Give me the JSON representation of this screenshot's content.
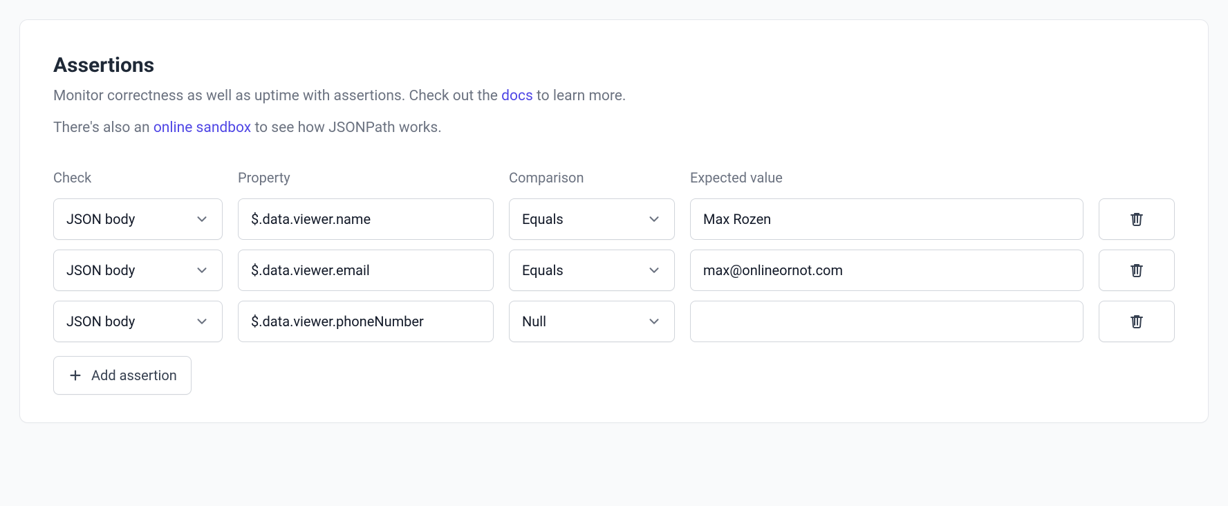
{
  "heading": "Assertions",
  "description": {
    "line1_pre": "Monitor correctness as well as uptime with assertions. Check out the ",
    "line1_link": "docs",
    "line1_post": " to learn more.",
    "line2_pre": "There's also an ",
    "line2_link": "online sandbox",
    "line2_post": " to see how JSONPath works."
  },
  "columns": {
    "check": "Check",
    "property": "Property",
    "comparison": "Comparison",
    "expected": "Expected value"
  },
  "rows": [
    {
      "check": "JSON body",
      "property": "$.data.viewer.name",
      "comparison": "Equals",
      "expected": "Max Rozen"
    },
    {
      "check": "JSON body",
      "property": "$.data.viewer.email",
      "comparison": "Equals",
      "expected": "max@onlineornot.com"
    },
    {
      "check": "JSON body",
      "property": "$.data.viewer.phoneNumber",
      "comparison": "Null",
      "expected": ""
    }
  ],
  "add_button": "Add assertion"
}
